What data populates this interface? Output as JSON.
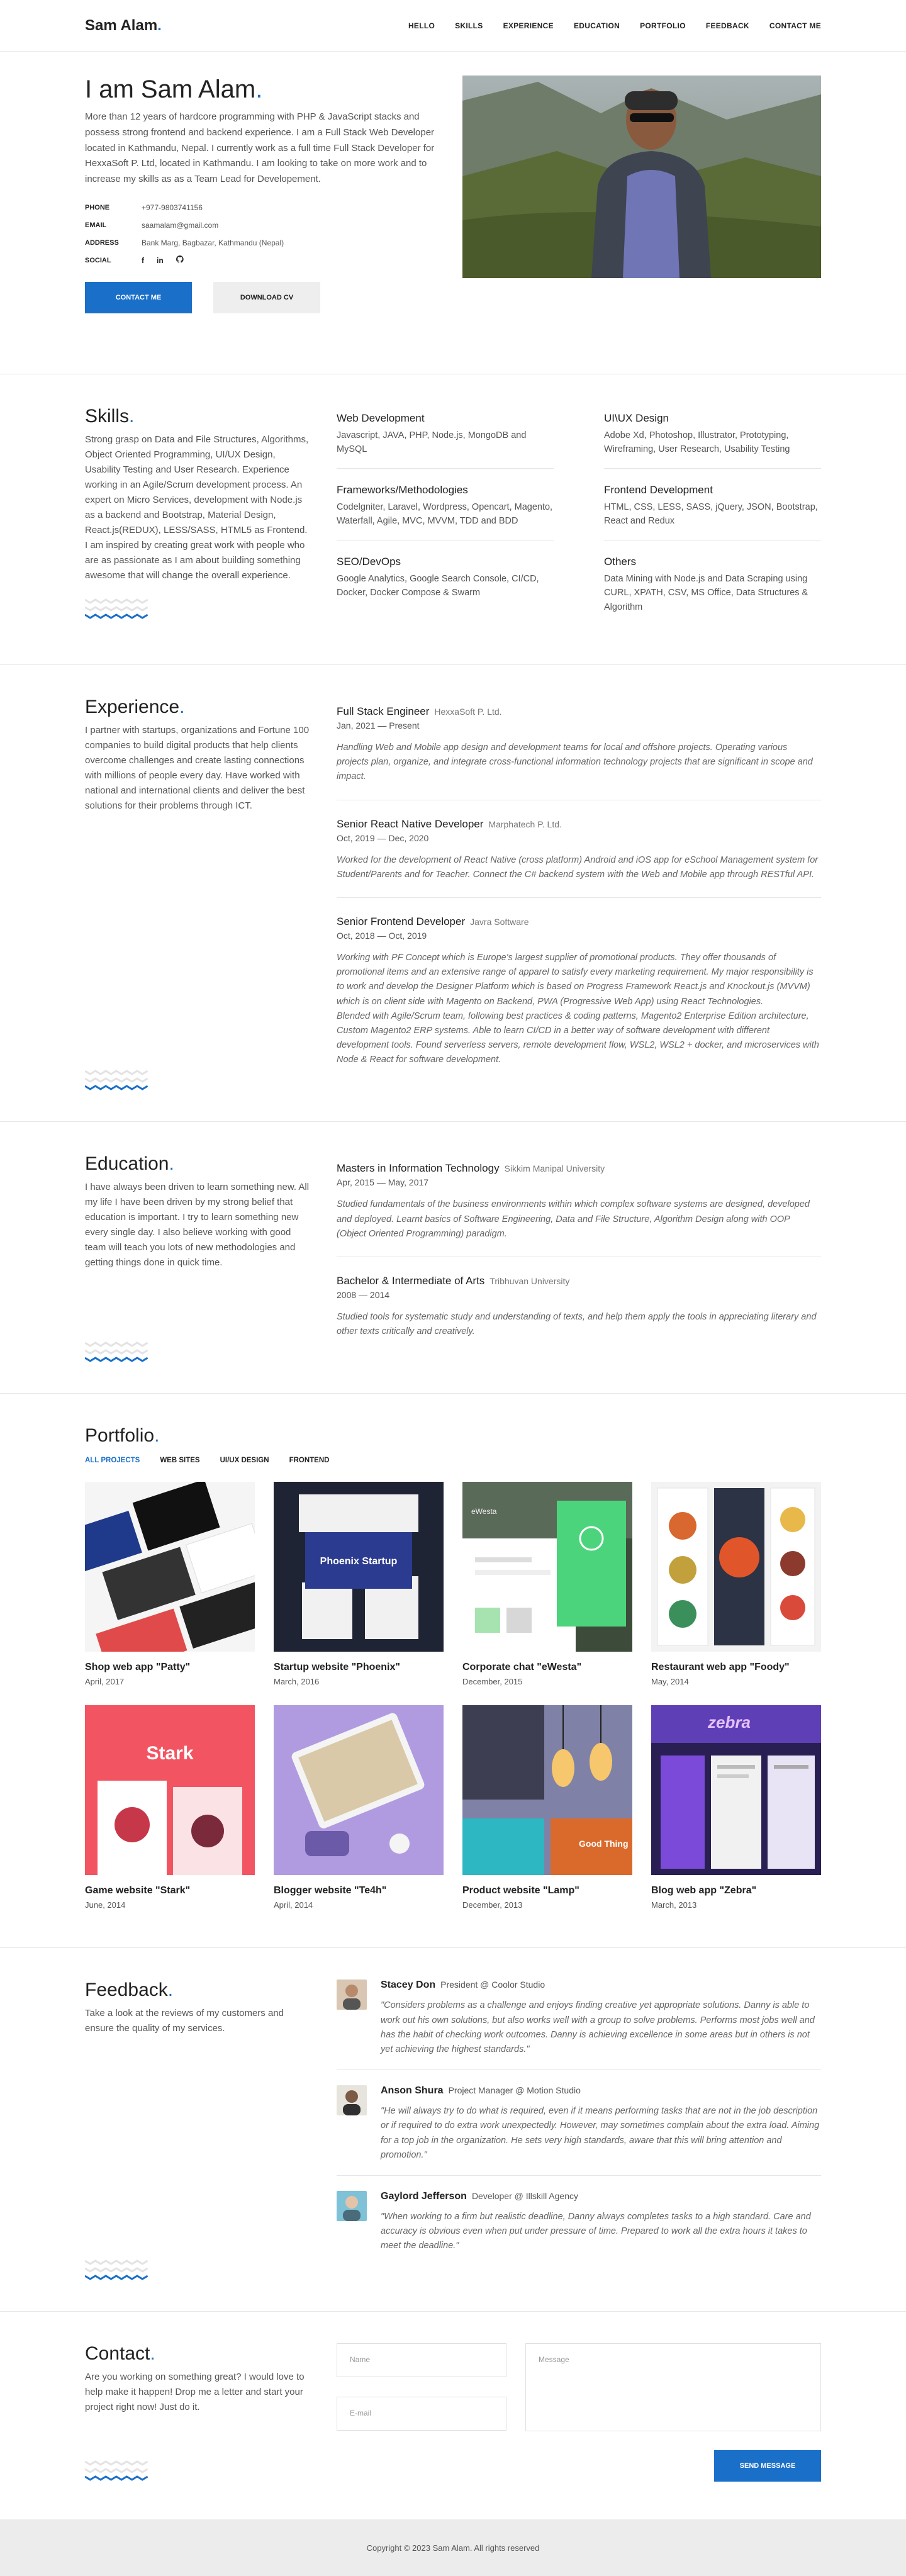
{
  "nav": {
    "logo": "Sam Alam",
    "logo_dot": ".",
    "items": [
      "HELLO",
      "SKILLS",
      "EXPERIENCE",
      "EDUCATION",
      "PORTFOLIO",
      "FEEDBACK",
      "CONTACT ME"
    ]
  },
  "hero": {
    "title": "I am Sam Alam",
    "title_dot": ".",
    "text": "More than 12 years of hardcore programming with PHP & JavaScript stacks and possess strong frontend and backend experience. I am a Full Stack Web Developer located in Kathmandu, Nepal. I currently work as a full time Full Stack Developer for HexxaSoft P. Ltd, located in Kathmandu. I am looking to take on more work and to increase my skills as as a Team Lead for Developement.",
    "info": [
      {
        "k": "PHONE",
        "v": "+977-9803741156"
      },
      {
        "k": "EMAIL",
        "v": "saamalam@gmail.com"
      },
      {
        "k": "ADDRESS",
        "v": "Bank Marg, Bagbazar, Kathmandu (Nepal)"
      }
    ],
    "social_label": "SOCIAL",
    "socials": [
      "f",
      "in",
      "gh"
    ],
    "btn_contact": "CONTACT ME",
    "btn_cv": "DOWNLOAD CV"
  },
  "skills": {
    "title": "Skills",
    "text": "Strong grasp on Data and File Structures, Algorithms, Object Oriented Programming, UI/UX Design, Usability Testing and User Research. Experience working in an Agile/Scrum development process. An expert on Micro Services, development with Node.js as a backend and Bootstrap, Material Design, React.js(REDUX), LESS/SASS, HTML5 as Frontend. I am inspired by creating great work with people who are as passionate as I am about building something awesome that will change the overall experience.",
    "items": [
      {
        "title": "Web Development",
        "text": "Javascript, JAVA, PHP, Node.js, MongoDB and MySQL"
      },
      {
        "title": "UI\\UX Design",
        "text": "Adobe Xd, Photoshop, Illustrator, Prototyping, Wireframing, User Research, Usability Testing"
      },
      {
        "title": "Frameworks/Methodologies",
        "text": "Codelgniter, Laravel, Wordpress, Opencart, Magento, Waterfall, Agile, MVC, MVVM, TDD and BDD"
      },
      {
        "title": "Frontend Development",
        "text": "HTML, CSS, LESS, SASS, jQuery, JSON, Bootstrap, React and Redux"
      },
      {
        "title": "SEO/DevOps",
        "text": "Google Analytics, Google Search Console, CI/CD, Docker, Docker Compose & Swarm"
      },
      {
        "title": "Others",
        "text": "Data Mining with Node.js and Data Scraping using CURL, XPATH, CSV, MS Office, Data Structures & Algorithm"
      }
    ]
  },
  "experience": {
    "title": "Experience",
    "text": "I partner with startups, organizations and Fortune 100 companies to build digital products that help clients overcome challenges and create lasting connections with millions of people every day. Have worked with national and international clients and deliver the best solutions for their problems through ICT.",
    "jobs": [
      {
        "role": "Full Stack Engineer",
        "company": "HexxaSoft P. Ltd.",
        "date": "Jan, 2021 — Present",
        "desc": "Handling Web and Mobile app design and development teams for local and offshore projects. Operating various projects plan, organize, and integrate cross-functional information technology projects that are significant in scope and impact."
      },
      {
        "role": "Senior React Native Developer",
        "company": "Marphatech P. Ltd.",
        "date": "Oct, 2019 — Dec, 2020",
        "desc": "Worked for the development of React Native (cross platform) Android and iOS app for eSchool Management system for Student/Parents and for Teacher. Connect the C# backend system with the Web and Mobile app through RESTful API."
      },
      {
        "role": "Senior Frontend Developer",
        "company": "Javra Software",
        "date": "Oct, 2018 — Oct, 2019",
        "desc": "Working with PF Concept which is Europe's largest supplier of promotional products. They offer thousands of promotional items and an extensive range of apparel to satisfy every marketing requirement. My major responsibility is to work and develop the Designer Platform which is based on Progress Framework React.js and Knockout.js (MVVM) which is on client side with Magento on Backend, PWA (Progressive Web App) using React Technologies.\nBlended with Agile/Scrum team, following best practices & coding patterns, Magento2 Enterprise Edition architecture, Custom Magento2 ERP systems. Able to learn CI/CD in a better way of software development with different development tools. Found serverless servers, remote development flow, WSL2, WSL2 + docker, and microservices with Node & React for software development."
      }
    ]
  },
  "education": {
    "title": "Education",
    "text": "I have always been driven to learn something new. All my life I have been driven by my strong belief that education is important. I try to learn something new every single day. I also believe working with good team will teach you lots of new methodologies and getting things done in quick time.",
    "items": [
      {
        "degree": "Masters in Information Technology",
        "school": "Sikkim Manipal University",
        "date": "Apr, 2015 — May, 2017",
        "desc": "Studied fundamentals of the business environments within which complex software systems are designed, developed and deployed. Learnt basics of Software Engineering, Data and File Structure, Algorithm Design along with OOP (Object Oriented Programming) paradigm."
      },
      {
        "degree": "Bachelor & Intermediate of Arts",
        "school": "Tribhuvan University",
        "date": "2008 — 2014",
        "desc": "Studied tools for systematic study and understanding of texts, and help them apply the tools in appreciating literary and other texts critically and creatively."
      }
    ]
  },
  "portfolio": {
    "title": "Portfolio",
    "filters": [
      "ALL PROJECTS",
      "WEB SITES",
      "UI/UX DESIGN",
      "FRONTEND"
    ],
    "items": [
      {
        "title": "Shop web app \"Patty\"",
        "date": "April, 2017",
        "thumb_text": "",
        "bg": "#ffffff"
      },
      {
        "title": "Startup website \"Phoenix\"",
        "date": "March, 2016",
        "thumb_text": "Phoenix Startup",
        "bg": "#1f2434"
      },
      {
        "title": "Corporate chat \"eWesta\"",
        "date": "December, 2015",
        "thumb_text": "eWesta",
        "bg": "#6dbf4b"
      },
      {
        "title": "Restaurant web app \"Foody\"",
        "date": "May, 2014",
        "thumb_text": "",
        "bg": "#f3f3f3"
      },
      {
        "title": "Game website \"Stark\"",
        "date": "June, 2014",
        "thumb_text": "Stark",
        "bg": "#f25561"
      },
      {
        "title": "Blogger website \"Te4h\"",
        "date": "April, 2014",
        "thumb_text": "",
        "bg": "#b09be0"
      },
      {
        "title": "Product website \"Lamp\"",
        "date": "December, 2013",
        "thumb_text": "Good Thing",
        "bg": "#8a8ab0"
      },
      {
        "title": "Blog web app \"Zebra\"",
        "date": "March, 2013",
        "thumb_text": "zebra",
        "bg": "#5f3fb5"
      }
    ]
  },
  "feedback": {
    "title": "Feedback",
    "text": "Take a look at the reviews of my customers and ensure the quality of my services.",
    "items": [
      {
        "name": "Stacey Don",
        "role": "President @ Coolor Studio",
        "text": "\"Considers problems as a challenge and enjoys finding creative yet appropriate solutions. Danny is able to work out his own solutions, but also works well with a group to solve problems. Performs most jobs well and has the habit of checking work outcomes. Danny is achieving excellence in some areas but in others is not yet achieving the highest standards.\"",
        "color": "#b78a6b"
      },
      {
        "name": "Anson Shura",
        "role": "Project Manager @ Motion Studio",
        "text": "\"He will always try to do what is required, even if it means performing tasks that are not in the job description or if required to do extra work unexpectedly. However, may sometimes complain about the extra load. Aiming for a top job in the organization. He sets very high standards, aware that this will bring attention and promotion.\"",
        "color": "#7b5a46"
      },
      {
        "name": "Gaylord Jefferson",
        "role": "Developer @ Illskill Agency",
        "text": "\"When working to a firm but realistic deadline, Danny always completes tasks to a high standard. Care and accuracy is obvious even when put under pressure of time. Prepared to work all the extra hours it takes to meet the deadline.\"",
        "color": "#6fb0c7"
      }
    ]
  },
  "contact": {
    "title": "Contact",
    "text": "Are you working on something great? I would love to help make it happen! Drop me a letter and start your project right now! Just do it.",
    "name_placeholder": "Name",
    "email_placeholder": "E-mail",
    "message_placeholder": "Message",
    "send": "SEND MESSAGE"
  },
  "footer": {
    "text": "Copyright © 2023 Sam Alam. All rights reserved"
  },
  "colors": {
    "accent": "#1a6fc9"
  }
}
